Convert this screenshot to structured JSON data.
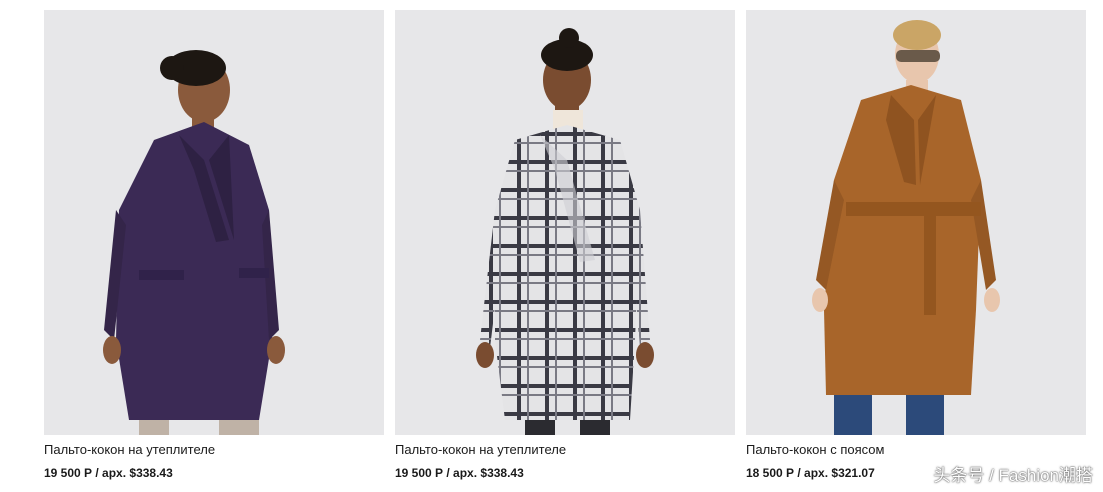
{
  "products": [
    {
      "title": "Пальто-кокон на утеплителе",
      "price": "19 500 Р / apx. $338.43",
      "image_alt": "purple-cocoon-coat-photo",
      "coat_color": "#3b2a55"
    },
    {
      "title": "Пальто-кокон на утеплителе",
      "price": "19 500 Р / apx. $338.43",
      "image_alt": "plaid-cocoon-coat-photo",
      "coat_color": "#d9d9dc"
    },
    {
      "title": "Пальто-кокон с поясом",
      "price": "18 500 Р / apx. $321.07",
      "image_alt": "camel-belted-coat-photo",
      "coat_color": "#a8652a"
    }
  ],
  "watermark": "头条号 / Fashion潮搭"
}
